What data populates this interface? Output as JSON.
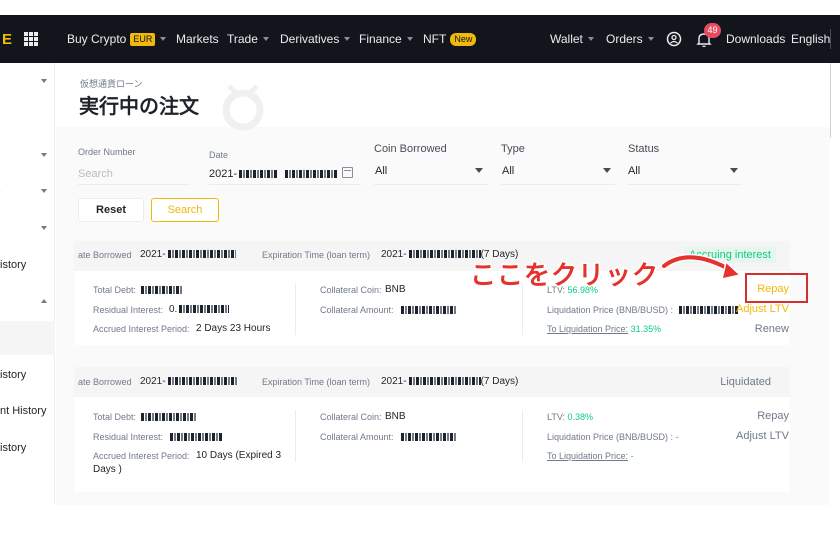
{
  "nav": {
    "logo_letter": "E",
    "buy_crypto": "Buy Crypto",
    "currency_badge": "EUR",
    "markets": "Markets",
    "trade": "Trade",
    "derivatives": "Derivatives",
    "finance": "Finance",
    "nft": "NFT",
    "nft_badge": "New",
    "wallet": "Wallet",
    "orders": "Orders",
    "notification_count": "49",
    "downloads": "Downloads",
    "language": "English"
  },
  "sidebar": {
    "items": [
      {
        "label": "istory"
      },
      {
        "label": "istory"
      },
      {
        "label": "nt History"
      },
      {
        "label": "istory"
      }
    ]
  },
  "page": {
    "breadcrumb": "仮想通貨ローン",
    "title": "実行中の注文"
  },
  "filters": {
    "order_number_label": "Order Number",
    "order_number_placeholder": "Search",
    "date_label": "Date",
    "date_value": "2021-",
    "coin_borrowed_label": "Coin Borrowed",
    "coin_borrowed_value": "All",
    "type_label": "Type",
    "type_value": "All",
    "status_label": "Status",
    "status_value": "All",
    "reset": "Reset",
    "search": "Search"
  },
  "orders": [
    {
      "date_borrowed_label": "ate Borrowed",
      "date_borrowed": "2021-",
      "expiration_label": "Expiration Time (loan term)",
      "expiration_prefix": "2021-",
      "expiration_term": "(7 Days)",
      "status": "Accruing interest",
      "total_debt_label": "Total Debt:",
      "residual_interest_label": "Residual Interest:",
      "residual_interest_prefix": "0.",
      "accrued_period_label": "Accrued Interest Period:",
      "accrued_period": "2 Days 23 Hours",
      "collateral_coin_label": "Collateral Coin:",
      "collateral_coin": "BNB",
      "collateral_amount_label": "Collateral Amount:",
      "ltv_label": "LTV:",
      "ltv": "56.98%",
      "liq_price_label": "Liquidation Price (BNB/BUSD) :",
      "liq_price_prefix": "",
      "to_liq_label": "To Liquidation Price:",
      "to_liq": "31.35%",
      "action_repay": "Repay",
      "action_adjust": "Adjust LTV",
      "action_renew": "Renew"
    },
    {
      "date_borrowed_label": "ate Borrowed",
      "date_borrowed": "2021-",
      "expiration_label": "Expiration Time (loan term)",
      "expiration_prefix": "2021-",
      "expiration_term": "(7 Days)",
      "status": "Liquidated",
      "total_debt_label": "Total Debt:",
      "residual_interest_label": "Residual Interest:",
      "accrued_period_label": "Accrued Interest Period:",
      "accrued_period_line1": "10 Days (Expired 3",
      "accrued_period_line2": "Days )",
      "collateral_coin_label": "Collateral Coin:",
      "collateral_coin": "BNB",
      "collateral_amount_label": "Collateral Amount:",
      "ltv_label": "LTV:",
      "ltv": "0.38%",
      "liq_price_label": "Liquidation Price (BNB/BUSD) :",
      "liq_price": "-",
      "to_liq_label": "To Liquidation Price:",
      "to_liq": "-",
      "action_repay": "Repay",
      "action_adjust": "Adjust LTV"
    }
  ],
  "annotation": {
    "text": "ここをクリック",
    "color": "#e5322d"
  },
  "colors": {
    "accent": "#f0b90b",
    "positive": "#0ecb81",
    "nav_bg": "#12161c"
  }
}
